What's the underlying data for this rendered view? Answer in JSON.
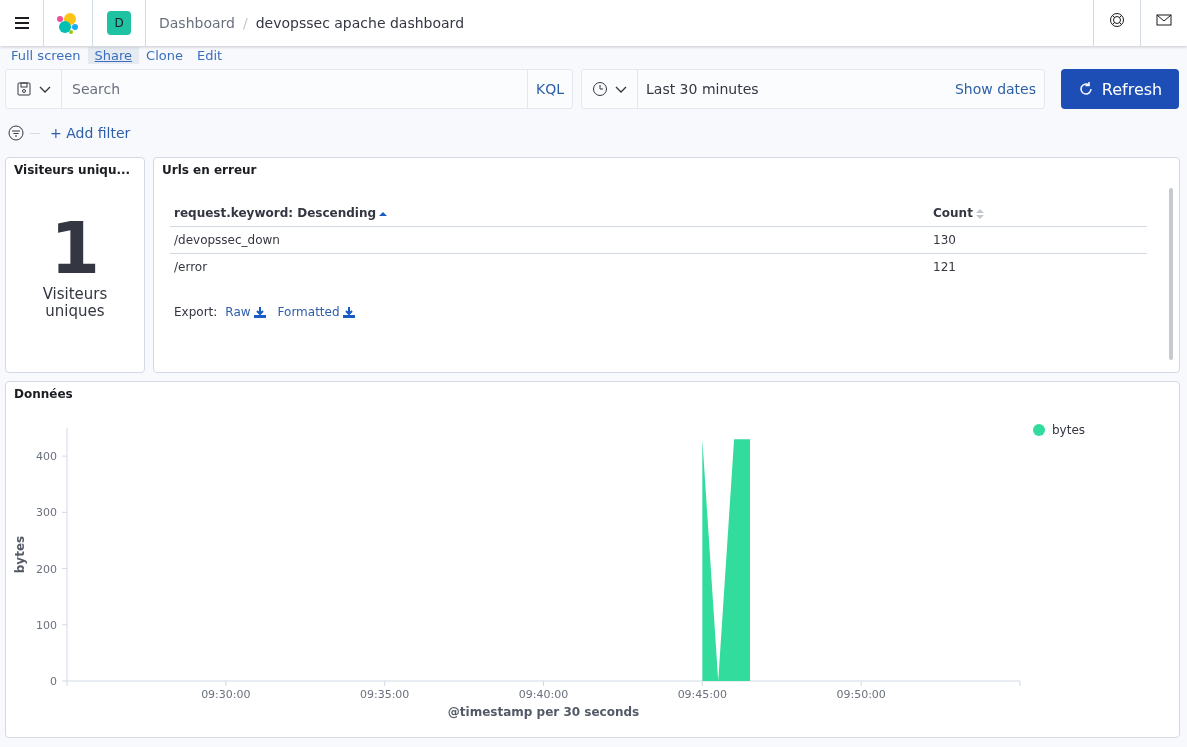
{
  "header": {
    "breadcrumbs": [
      {
        "label": "Dashboard",
        "selected": false
      },
      {
        "label": "devopssec apache dashboard",
        "selected": true
      }
    ],
    "breadcrumb_separator": "/",
    "space_avatar": "D"
  },
  "top_menu": [
    {
      "label": "Full screen",
      "selected": false
    },
    {
      "label": "Share",
      "selected": true
    },
    {
      "label": "Clone",
      "selected": false
    },
    {
      "label": "Edit",
      "selected": false
    }
  ],
  "query_bar": {
    "placeholder": "Search",
    "language": "KQL",
    "time_range": "Last 30 minutes",
    "show_dates": "Show dates",
    "refresh": "Refresh"
  },
  "filter_bar": {
    "add_filter": "+ Add filter"
  },
  "panels": [
    {
      "kind": "metric",
      "title": "Visiteurs uniqu...",
      "value": "1",
      "label": "Visiteurs uniques"
    },
    {
      "kind": "table",
      "title": "Urls en erreur",
      "columns": [
        {
          "label": "request.keyword: Descending",
          "sorted": true
        },
        {
          "label": "Count",
          "sorted": false
        }
      ],
      "rows": [
        [
          "/devopssec_down",
          "130"
        ],
        [
          "/error",
          "121"
        ]
      ],
      "export": {
        "label": "Export:",
        "links": [
          "Raw",
          "Formatted"
        ]
      }
    },
    {
      "kind": "chart",
      "title": "Données",
      "chart_data": {
        "type": "area",
        "xlabel": "@timestamp per 30 seconds",
        "ylabel": "bytes",
        "categories": [
          null,
          null,
          null,
          null,
          null,
          null,
          null,
          null,
          null,
          null,
          "09:30:00",
          null,
          null,
          null,
          null,
          null,
          null,
          null,
          null,
          null,
          "09:35:00",
          null,
          null,
          null,
          null,
          null,
          null,
          null,
          null,
          null,
          "09:40:00",
          null,
          null,
          null,
          null,
          null,
          null,
          null,
          null,
          null,
          "09:45:00",
          null,
          null,
          null,
          null,
          null,
          null,
          null,
          null,
          null,
          "09:50:00",
          null,
          null,
          null,
          null,
          null,
          null,
          null,
          null,
          null,
          null
        ],
        "series": [
          {
            "name": "bytes",
            "color": "#32dc9c",
            "values": [
              null,
              null,
              null,
              null,
              null,
              null,
              null,
              null,
              null,
              null,
              null,
              null,
              null,
              null,
              null,
              null,
              null,
              null,
              null,
              null,
              null,
              null,
              null,
              null,
              null,
              null,
              null,
              null,
              null,
              null,
              null,
              null,
              null,
              null,
              null,
              null,
              null,
              null,
              null,
              null,
              430,
              0,
              430,
              430,
              null,
              null,
              null,
              null,
              null,
              null,
              null,
              null,
              null,
              null,
              null,
              null,
              null,
              null,
              null,
              null,
              null
            ]
          }
        ],
        "ylim": [
          0,
          450
        ],
        "yticks": [
          0,
          100,
          200,
          300,
          400
        ]
      }
    }
  ]
}
